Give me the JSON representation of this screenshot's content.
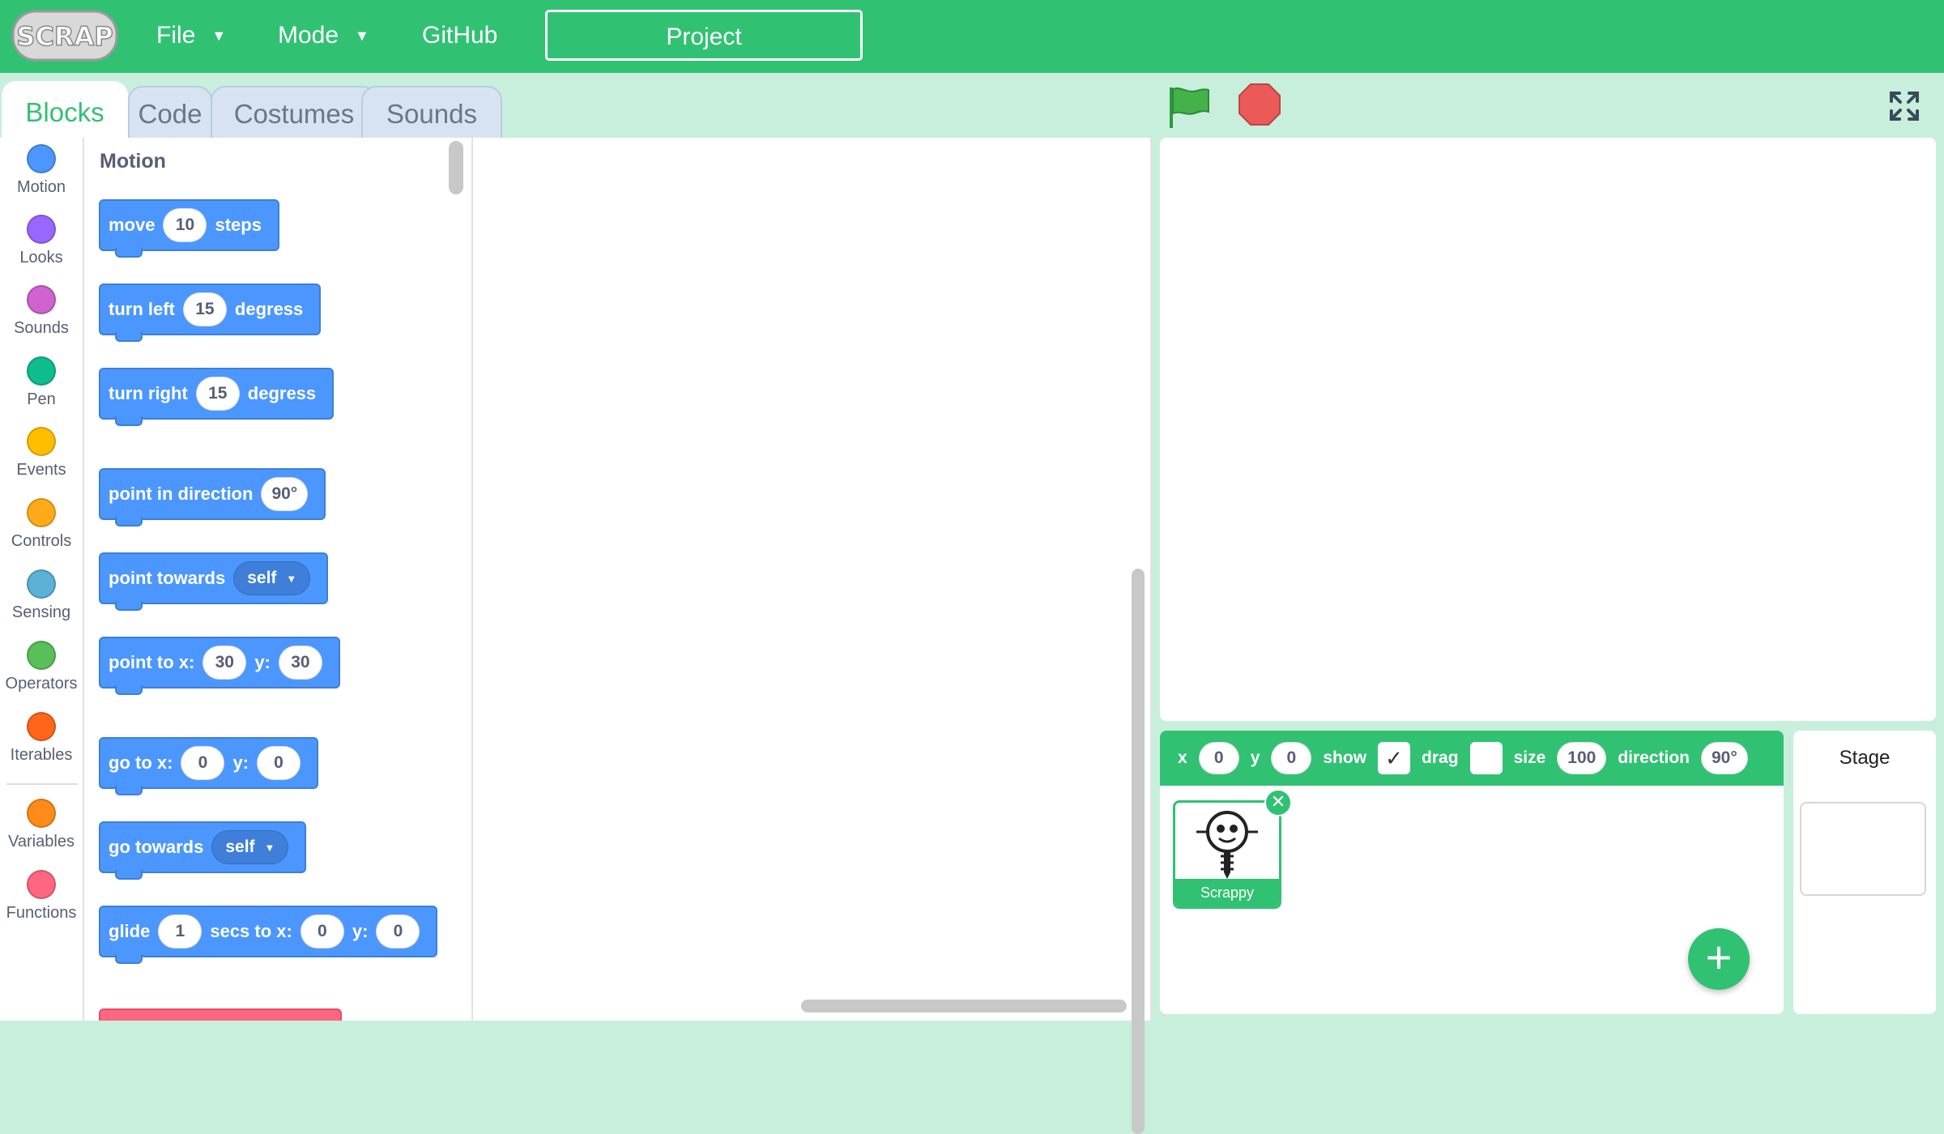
{
  "colors": {
    "brand_green": "#31c173",
    "workspace_bg": "#c8efdb",
    "motion_blue": "#4c97ff"
  },
  "header": {
    "logo_text": "SCRAP",
    "menus": [
      {
        "label": "File",
        "icon": "caret-down-icon"
      },
      {
        "label": "Mode",
        "icon": "caret-down-icon"
      },
      {
        "label": "GitHub"
      }
    ],
    "project_label": "Project"
  },
  "tabs": [
    {
      "label": "Blocks",
      "active": true
    },
    {
      "label": "Code",
      "active": false
    },
    {
      "label": "Costumes",
      "active": false
    },
    {
      "label": "Sounds",
      "active": false
    }
  ],
  "categories": [
    {
      "label": "Motion",
      "color": "#4c97ff"
    },
    {
      "label": "Looks",
      "color": "#9966ff"
    },
    {
      "label": "Sounds",
      "color": "#cf63cf"
    },
    {
      "label": "Pen",
      "color": "#0fbd8c"
    },
    {
      "label": "Events",
      "color": "#ffbf00"
    },
    {
      "label": "Controls",
      "color": "#ffab19"
    },
    {
      "label": "Sensing",
      "color": "#5cb1d6"
    },
    {
      "label": "Operators",
      "color": "#59c059"
    },
    {
      "label": "Iterables",
      "color": "#ff661a"
    },
    {
      "label": "Variables",
      "color": "#ff8c1a"
    },
    {
      "label": "Functions",
      "color": "#ff6680"
    }
  ],
  "palette": {
    "title": "Motion",
    "blocks": {
      "move": {
        "a": "move",
        "v1": "10",
        "b": "steps"
      },
      "turn_left": {
        "a": "turn left",
        "v1": "15",
        "b": "degress"
      },
      "turn_right": {
        "a": "turn right",
        "v1": "15",
        "b": "degress"
      },
      "point_dir": {
        "a": "point in direction",
        "v1": "90°"
      },
      "point_towards": {
        "a": "point towards",
        "dd": "self"
      },
      "point_to": {
        "a": "point to x:",
        "v1": "30",
        "b": "y:",
        "v2": "30"
      },
      "go_to": {
        "a": "go to x:",
        "v1": "0",
        "b": "y:",
        "v2": "0"
      },
      "go_towards": {
        "a": "go towards",
        "dd": "self"
      },
      "glide": {
        "a": "glide",
        "v1": "1",
        "b": "secs to x:",
        "v2": "0",
        "c": "y:",
        "v3": "0"
      }
    }
  },
  "controls": {
    "flag_icon": "green-flag-icon",
    "stop_icon": "stop-sign-icon",
    "fullscreen_icon": "fullscreen-icon"
  },
  "sprite_info": {
    "x_label": "x",
    "x": "0",
    "y_label": "y",
    "y": "0",
    "show_label": "show",
    "show": true,
    "show_mark": "✓",
    "drag_label": "drag",
    "drag": false,
    "size_label": "size",
    "size": "100",
    "direction_label": "direction",
    "direction": "90°"
  },
  "sprites": [
    {
      "name": "Scrappy",
      "selected": true
    }
  ],
  "stage_panel": {
    "label": "Stage"
  }
}
